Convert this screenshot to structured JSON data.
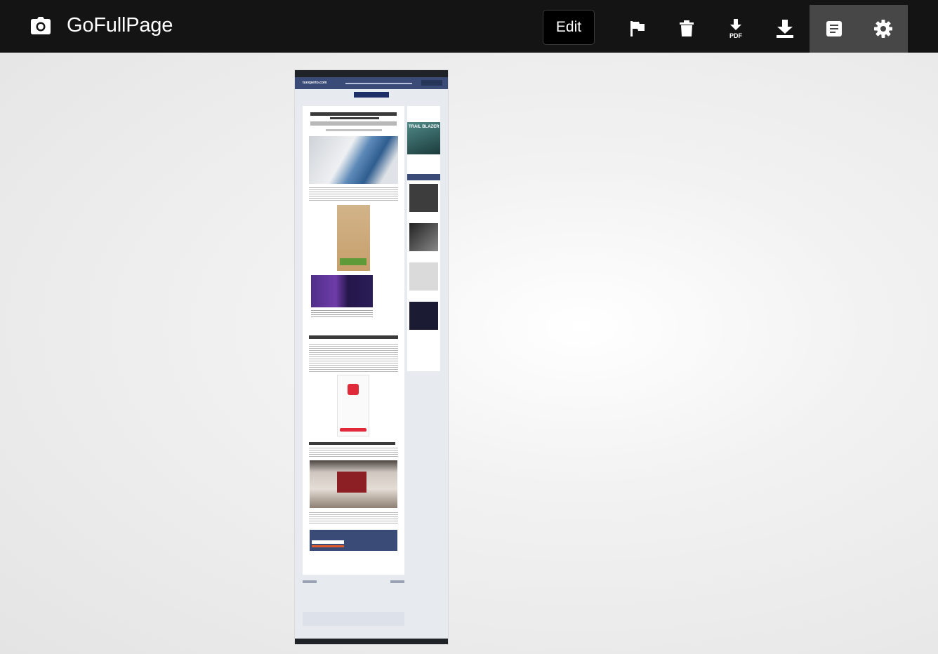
{
  "toolbar": {
    "brand": "GoFullPage",
    "edit_label": "Edit",
    "icons": {
      "logo": "camera-icon",
      "flag": "flag-icon",
      "trash": "trash-icon",
      "pdf": "pdf-download-icon",
      "pdf_text": "PDF",
      "download": "download-icon",
      "page": "page-icon",
      "settings": "gear-icon"
    },
    "active_tools": [
      "page",
      "settings"
    ]
  },
  "preview": {
    "site_name": "tuexperto.com",
    "sidebar_ad_text": "TRAIL BLAZER"
  },
  "colors": {
    "toolbar_bg": "#141414",
    "active_tool_bg": "#474747",
    "site_header": "#3b4b78"
  }
}
